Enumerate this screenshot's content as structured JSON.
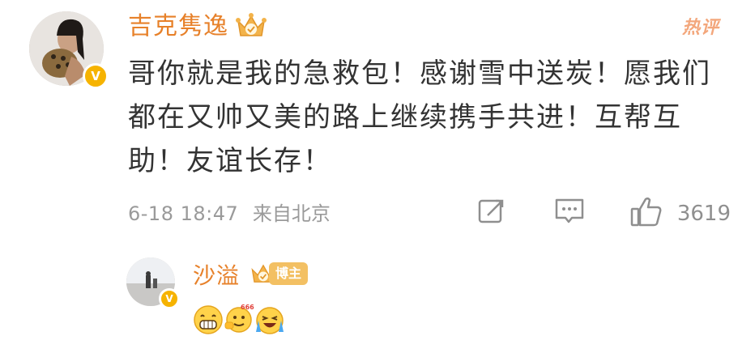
{
  "comment": {
    "username": "吉克隽逸",
    "hot_label": "热评",
    "text": "哥你就是我的急救包！感谢雪中送炭！愿我们都在又帅又美的路上继续携手共进！互帮互助！友谊长存！",
    "timestamp": "6-18 18:47",
    "location": "来自北京",
    "like_count": "3619"
  },
  "reply": {
    "username": "沙溢",
    "badge": "博主",
    "emojis": [
      "grin-emoji",
      "666-emoji",
      "crying-laugh-emoji"
    ]
  },
  "colors": {
    "username": "#e7812a",
    "hot_tag": "#f3a77c",
    "verified_badge": "#f6b300",
    "text": "#333333",
    "meta": "#9a9a9a"
  },
  "icons": {
    "verified": "V",
    "repost": "repost-icon",
    "comment": "comment-icon",
    "like": "like-icon"
  }
}
